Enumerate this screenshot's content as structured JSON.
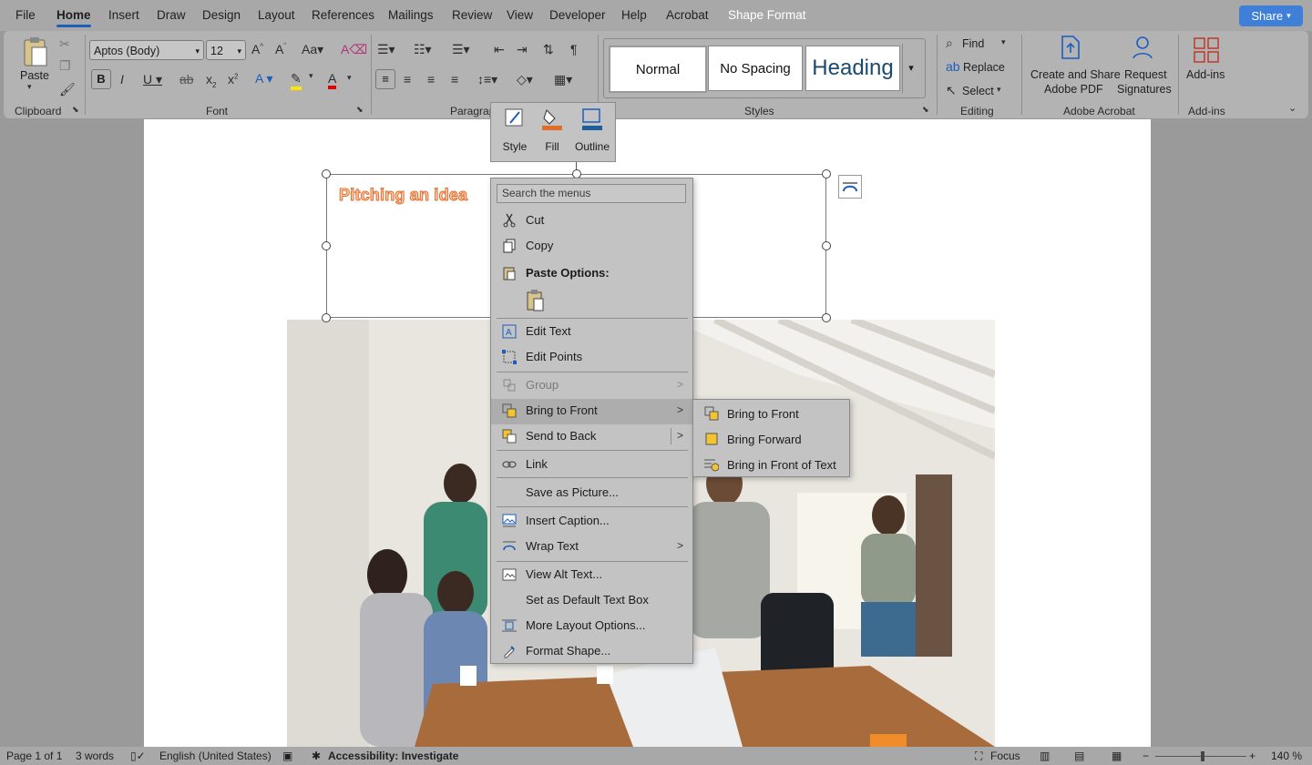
{
  "tabs": [
    "File",
    "Home",
    "Insert",
    "Draw",
    "Design",
    "Layout",
    "References",
    "Mailings",
    "Review",
    "View",
    "Developer",
    "Help",
    "Acrobat",
    "Shape Format"
  ],
  "share_label": "Share",
  "ribbon": {
    "clipboard": {
      "paste": "Paste",
      "label": "Clipboard"
    },
    "font": {
      "name": "Aptos (Body)",
      "size": "12",
      "label": "Font"
    },
    "paragraph": {
      "label": "Paragraph"
    },
    "styles": {
      "normal": "Normal",
      "no_spacing": "No Spacing",
      "heading": "Heading",
      "label": "Styles"
    },
    "editing": {
      "find": "Find",
      "replace": "Replace",
      "select": "Select",
      "label": "Editing"
    },
    "acrobat": {
      "create": "Create and Share",
      "create2": "Adobe PDF",
      "request": "Request",
      "request2": "Signatures",
      "label": "Adobe Acrobat"
    },
    "addins": {
      "button": "Add-ins",
      "label": "Add-ins"
    }
  },
  "mini_toolbar": {
    "style": "Style",
    "fill": "Fill",
    "outline": "Outline"
  },
  "textbox_text": "Pitching an idea",
  "context_menu": {
    "search_placeholder": "Search the menus",
    "cut": "Cut",
    "copy": "Copy",
    "paste_options": "Paste Options:",
    "edit_text": "Edit Text",
    "edit_points": "Edit Points",
    "group": "Group",
    "bring_to_front": "Bring to Front",
    "send_to_back": "Send to Back",
    "link": "Link",
    "save_as_picture": "Save as Picture...",
    "insert_caption": "Insert Caption...",
    "wrap_text": "Wrap Text",
    "view_alt_text": "View Alt Text...",
    "set_default": "Set as Default Text Box",
    "more_layout": "More Layout Options...",
    "format_shape": "Format Shape..."
  },
  "submenu": {
    "bring_to_front": "Bring to Front",
    "bring_forward": "Bring Forward",
    "bring_in_front_of_text": "Bring in Front of Text"
  },
  "status": {
    "page": "Page 1 of 1",
    "words": "3 words",
    "language": "English (United States)",
    "accessibility": "Accessibility: Investigate",
    "focus": "Focus",
    "zoom": "140 %"
  },
  "colors": {
    "accent": "#1b5ebe",
    "text_fill": "#fbd1ba",
    "text_outline": "#e36c2a",
    "fill_swatch": "#e36c2a",
    "outline_swatch": "#1f5e9c"
  }
}
